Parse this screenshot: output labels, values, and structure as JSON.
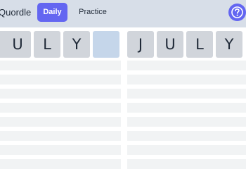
{
  "header": {
    "app_title": "Quordle",
    "tabs": [
      {
        "label": "Daily",
        "active": true
      },
      {
        "label": "Practice",
        "active": false
      }
    ],
    "help_icon": "question-circle-icon",
    "accent_color": "#6366f1"
  },
  "boards": [
    {
      "guess_row": [
        "",
        "U",
        "L",
        "Y",
        ""
      ]
    },
    {
      "guess_row": [
        "J",
        "U",
        "L",
        "Y",
        ""
      ]
    }
  ],
  "colors": {
    "header_bg": "#d7dee8",
    "tile_filled": "#d1d5db",
    "tile_current": "#c5d6ea",
    "empty_row": "#f1f3f4"
  }
}
